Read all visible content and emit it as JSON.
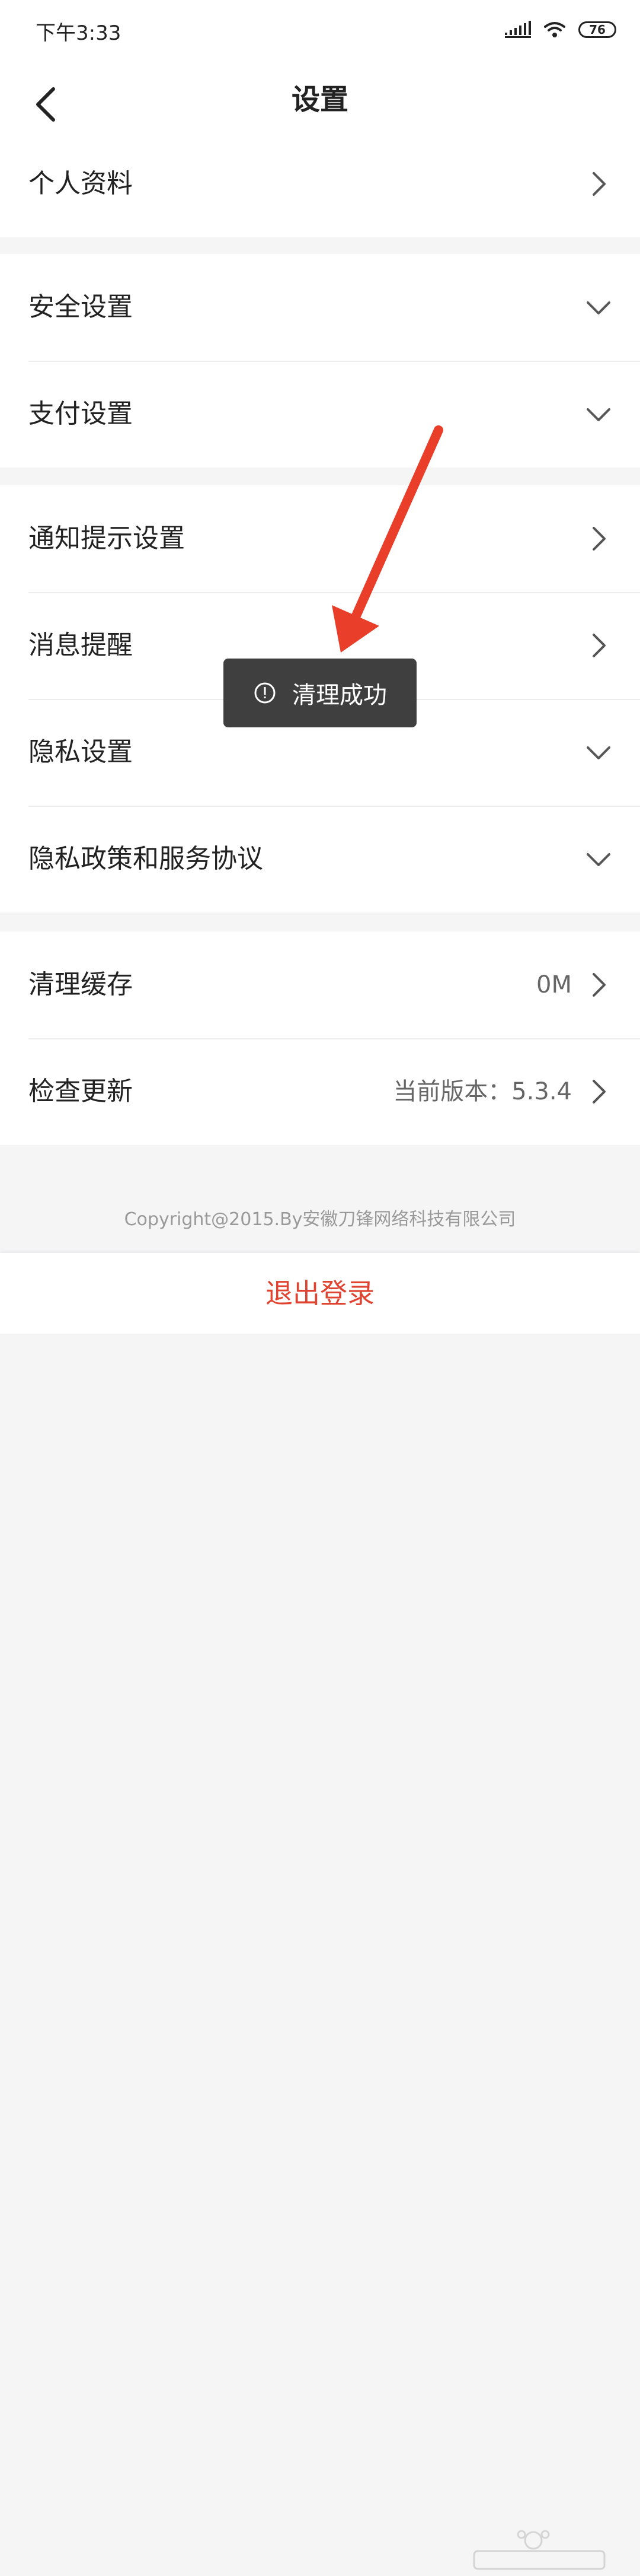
{
  "status_bar": {
    "time": "下午3:33",
    "battery": "76"
  },
  "header": {
    "title": "设置"
  },
  "groups": [
    {
      "items": [
        {
          "label": "个人资料",
          "icon": "chevron-right-icon"
        }
      ]
    },
    {
      "items": [
        {
          "label": "安全设置",
          "icon": "chevron-down-icon"
        },
        {
          "label": "支付设置",
          "icon": "chevron-down-icon"
        }
      ]
    },
    {
      "items": [
        {
          "label": "通知提示设置",
          "icon": "chevron-right-icon"
        },
        {
          "label": "消息提醒",
          "icon": "chevron-right-icon"
        },
        {
          "label": "隐私设置",
          "icon": "chevron-down-icon"
        },
        {
          "label": "隐私政策和服务协议",
          "icon": "chevron-down-icon"
        }
      ]
    },
    {
      "items": [
        {
          "label": "清理缓存",
          "value": "0M",
          "icon": "chevron-right-icon"
        },
        {
          "label": "检查更新",
          "value": "当前版本：5.3.4",
          "icon": "chevron-right-icon"
        }
      ]
    }
  ],
  "toast": {
    "text": "清理成功",
    "icon": "alert-circle-icon"
  },
  "footer": {
    "copyright": "Copyright@2015.By安徽刀锋网络科技有限公司"
  },
  "logout": {
    "label": "退出登录"
  },
  "colors": {
    "accent": "#e0432f",
    "arrow": "#e83e2a",
    "toast_bg": "#3f3f3f"
  }
}
